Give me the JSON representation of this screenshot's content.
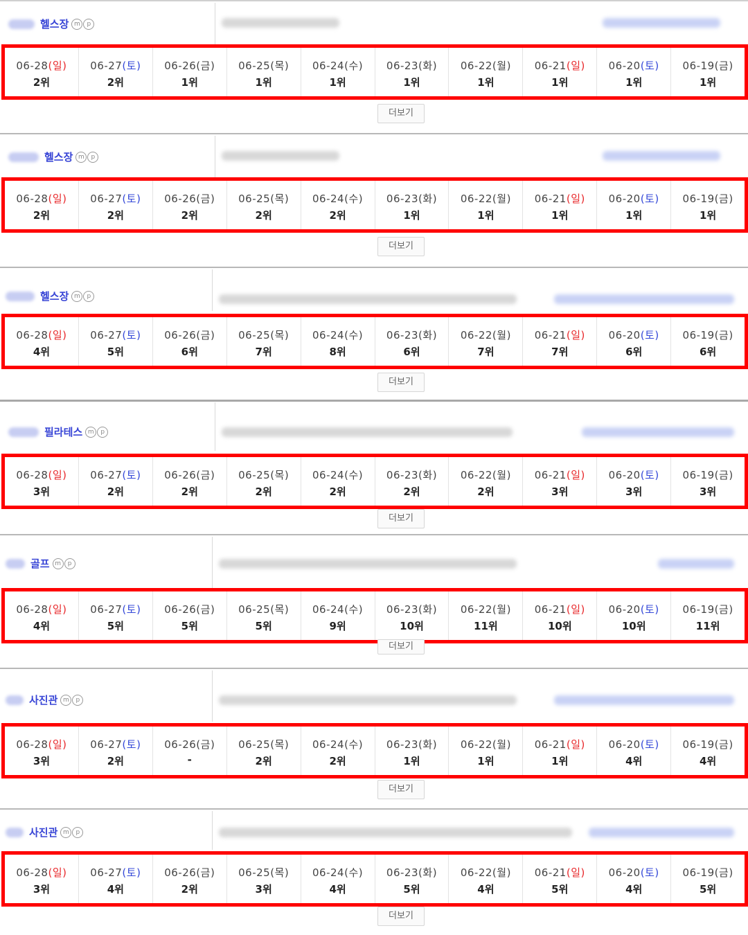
{
  "more_label": "더보기",
  "blocks": [
    {
      "keyword": "헬스장",
      "days": [
        {
          "date": "06-28",
          "wd": "일",
          "rank": "2위"
        },
        {
          "date": "06-27",
          "wd": "토",
          "rank": "2위"
        },
        {
          "date": "06-26",
          "wd": "금",
          "rank": "1위"
        },
        {
          "date": "06-25",
          "wd": "목",
          "rank": "1위"
        },
        {
          "date": "06-24",
          "wd": "수",
          "rank": "1위"
        },
        {
          "date": "06-23",
          "wd": "화",
          "rank": "1위"
        },
        {
          "date": "06-22",
          "wd": "월",
          "rank": "1위"
        },
        {
          "date": "06-21",
          "wd": "일",
          "rank": "1위"
        },
        {
          "date": "06-20",
          "wd": "토",
          "rank": "1위"
        },
        {
          "date": "06-19",
          "wd": "금",
          "rank": "1위"
        }
      ]
    },
    {
      "keyword": "헬스장",
      "days": [
        {
          "date": "06-28",
          "wd": "일",
          "rank": "2위"
        },
        {
          "date": "06-27",
          "wd": "토",
          "rank": "2위"
        },
        {
          "date": "06-26",
          "wd": "금",
          "rank": "2위"
        },
        {
          "date": "06-25",
          "wd": "목",
          "rank": "2위"
        },
        {
          "date": "06-24",
          "wd": "수",
          "rank": "2위"
        },
        {
          "date": "06-23",
          "wd": "화",
          "rank": "1위"
        },
        {
          "date": "06-22",
          "wd": "월",
          "rank": "1위"
        },
        {
          "date": "06-21",
          "wd": "일",
          "rank": "1위"
        },
        {
          "date": "06-20",
          "wd": "토",
          "rank": "1위"
        },
        {
          "date": "06-19",
          "wd": "금",
          "rank": "1위"
        }
      ]
    },
    {
      "keyword": "헬스장",
      "days": [
        {
          "date": "06-28",
          "wd": "일",
          "rank": "4위"
        },
        {
          "date": "06-27",
          "wd": "토",
          "rank": "5위"
        },
        {
          "date": "06-26",
          "wd": "금",
          "rank": "6위"
        },
        {
          "date": "06-25",
          "wd": "목",
          "rank": "7위"
        },
        {
          "date": "06-24",
          "wd": "수",
          "rank": "8위"
        },
        {
          "date": "06-23",
          "wd": "화",
          "rank": "6위"
        },
        {
          "date": "06-22",
          "wd": "월",
          "rank": "7위"
        },
        {
          "date": "06-21",
          "wd": "일",
          "rank": "7위"
        },
        {
          "date": "06-20",
          "wd": "토",
          "rank": "6위"
        },
        {
          "date": "06-19",
          "wd": "금",
          "rank": "6위"
        }
      ]
    },
    {
      "keyword": "필라테스",
      "days": [
        {
          "date": "06-28",
          "wd": "일",
          "rank": "3위"
        },
        {
          "date": "06-27",
          "wd": "토",
          "rank": "2위"
        },
        {
          "date": "06-26",
          "wd": "금",
          "rank": "2위"
        },
        {
          "date": "06-25",
          "wd": "목",
          "rank": "2위"
        },
        {
          "date": "06-24",
          "wd": "수",
          "rank": "2위"
        },
        {
          "date": "06-23",
          "wd": "화",
          "rank": "2위"
        },
        {
          "date": "06-22",
          "wd": "월",
          "rank": "2위"
        },
        {
          "date": "06-21",
          "wd": "일",
          "rank": "3위"
        },
        {
          "date": "06-20",
          "wd": "토",
          "rank": "3위"
        },
        {
          "date": "06-19",
          "wd": "금",
          "rank": "3위"
        }
      ]
    },
    {
      "keyword": "골프",
      "days": [
        {
          "date": "06-28",
          "wd": "일",
          "rank": "4위"
        },
        {
          "date": "06-27",
          "wd": "토",
          "rank": "5위"
        },
        {
          "date": "06-26",
          "wd": "금",
          "rank": "5위"
        },
        {
          "date": "06-25",
          "wd": "목",
          "rank": "5위"
        },
        {
          "date": "06-24",
          "wd": "수",
          "rank": "9위"
        },
        {
          "date": "06-23",
          "wd": "화",
          "rank": "10위"
        },
        {
          "date": "06-22",
          "wd": "월",
          "rank": "11위"
        },
        {
          "date": "06-21",
          "wd": "일",
          "rank": "10위"
        },
        {
          "date": "06-20",
          "wd": "토",
          "rank": "10위"
        },
        {
          "date": "06-19",
          "wd": "금",
          "rank": "11위"
        }
      ]
    },
    {
      "keyword": "사진관",
      "days": [
        {
          "date": "06-28",
          "wd": "일",
          "rank": "3위"
        },
        {
          "date": "06-27",
          "wd": "토",
          "rank": "2위"
        },
        {
          "date": "06-26",
          "wd": "금",
          "rank": "-"
        },
        {
          "date": "06-25",
          "wd": "목",
          "rank": "2위"
        },
        {
          "date": "06-24",
          "wd": "수",
          "rank": "2위"
        },
        {
          "date": "06-23",
          "wd": "화",
          "rank": "1위"
        },
        {
          "date": "06-22",
          "wd": "월",
          "rank": "1위"
        },
        {
          "date": "06-21",
          "wd": "일",
          "rank": "1위"
        },
        {
          "date": "06-20",
          "wd": "토",
          "rank": "4위"
        },
        {
          "date": "06-19",
          "wd": "금",
          "rank": "4위"
        }
      ]
    },
    {
      "keyword": "사진관",
      "days": [
        {
          "date": "06-28",
          "wd": "일",
          "rank": "3위"
        },
        {
          "date": "06-27",
          "wd": "토",
          "rank": "4위"
        },
        {
          "date": "06-26",
          "wd": "금",
          "rank": "2위"
        },
        {
          "date": "06-25",
          "wd": "목",
          "rank": "3위"
        },
        {
          "date": "06-24",
          "wd": "수",
          "rank": "4위"
        },
        {
          "date": "06-23",
          "wd": "화",
          "rank": "5위"
        },
        {
          "date": "06-22",
          "wd": "월",
          "rank": "4위"
        },
        {
          "date": "06-21",
          "wd": "일",
          "rank": "5위"
        },
        {
          "date": "06-20",
          "wd": "토",
          "rank": "4위"
        },
        {
          "date": "06-19",
          "wd": "금",
          "rank": "5위"
        }
      ]
    }
  ]
}
